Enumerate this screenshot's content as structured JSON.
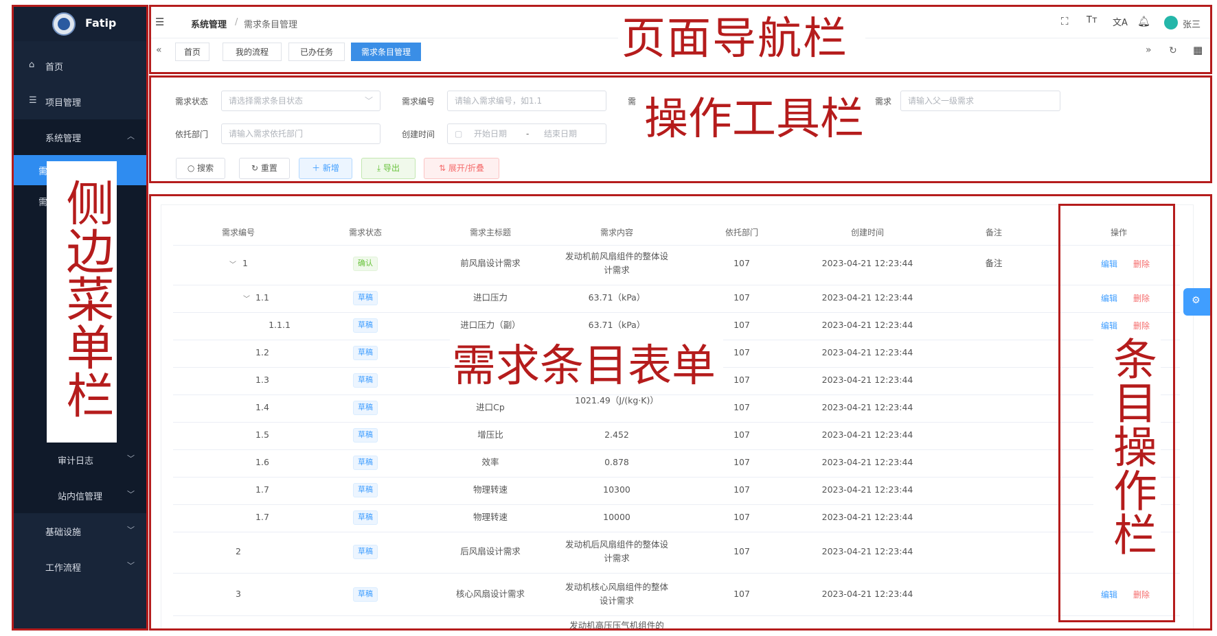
{
  "app": {
    "name": "Fatip"
  },
  "sidebar": {
    "items": [
      {
        "label": "首页",
        "icon": "home-icon"
      },
      {
        "label": "项目管理",
        "icon": "list-icon"
      },
      {
        "label": "系统管理",
        "icon": "chevron-up-icon"
      },
      {
        "label": "需"
      },
      {
        "label": "需"
      },
      {
        "label": "审计日志",
        "icon": "chevron-down-icon"
      },
      {
        "label": "站内信管理",
        "icon": "chevron-down-icon"
      },
      {
        "label": "基础设施",
        "icon": "chevron-down-icon"
      },
      {
        "label": "工作流程",
        "icon": "chevron-down-icon"
      }
    ]
  },
  "header": {
    "breadcrumb": [
      "系统管理",
      "需求条目管理"
    ],
    "breadcrumb_sep": "/",
    "user_name": "张三",
    "tabs": [
      "首页",
      "我的流程",
      "已办任务",
      "需求条目管理"
    ]
  },
  "toolbar": {
    "fields": {
      "status_label": "需求状态",
      "status_placeholder": "请选择需求条目状态",
      "code_label": "需求编号",
      "code_placeholder": "请输入需求编号，如1.1",
      "cut_label": "需",
      "parent_label": "需求",
      "parent_placeholder": "请输入父一级需求",
      "dept_label": "依托部门",
      "dept_placeholder": "请输入需求依托部门",
      "time_label": "创建时间",
      "start_placeholder": "开始日期",
      "range_sep": "-",
      "end_placeholder": "结束日期"
    },
    "buttons": {
      "search": "搜索",
      "reset": "重置",
      "add": "新增",
      "export": "导出",
      "toggle": "展开/折叠"
    }
  },
  "table": {
    "columns": [
      "需求编号",
      "需求状态",
      "需求主标题",
      "需求内容",
      "依托部门",
      "创建时间",
      "备注",
      "操作"
    ],
    "edit_label": "编辑",
    "delete_label": "删除",
    "rows": [
      {
        "code": "1",
        "status": "确认",
        "title": "前风扇设计需求",
        "content": "发动机前风扇组件的整体设计需求",
        "dept": "107",
        "time": "2023-04-21 12:23:44",
        "note": "备注"
      },
      {
        "code": "1.1",
        "status": "草稿",
        "title": "进口压力",
        "content": "63.71（kPa）",
        "dept": "107",
        "time": "2023-04-21 12:23:44",
        "note": ""
      },
      {
        "code": "1.1.1",
        "status": "草稿",
        "title": "进口压力（副）",
        "content": "63.71（kPa）",
        "dept": "107",
        "time": "2023-04-21 12:23:44",
        "note": ""
      },
      {
        "code": "1.2",
        "status": "草稿",
        "title": "",
        "content": "",
        "dept": "107",
        "time": "2023-04-21 12:23:44",
        "note": ""
      },
      {
        "code": "1.3",
        "status": "草稿",
        "title": "",
        "content": "",
        "dept": "107",
        "time": "2023-04-21 12:23:44",
        "note": ""
      },
      {
        "code": "1.4",
        "status": "草稿",
        "title": "进口Cp",
        "content": "1021.49（J/(kg·K)）",
        "dept": "107",
        "time": "2023-04-21 12:23:44",
        "note": ""
      },
      {
        "code": "1.5",
        "status": "草稿",
        "title": "增压比",
        "content": "2.452",
        "dept": "107",
        "time": "2023-04-21 12:23:44",
        "note": ""
      },
      {
        "code": "1.6",
        "status": "草稿",
        "title": "效率",
        "content": "0.878",
        "dept": "107",
        "time": "2023-04-21 12:23:44",
        "note": ""
      },
      {
        "code": "1.7",
        "status": "草稿",
        "title": "物理转速",
        "content": "10300",
        "dept": "107",
        "time": "2023-04-21 12:23:44",
        "note": ""
      },
      {
        "code": "1.7",
        "status": "草稿",
        "title": "物理转速",
        "content": "10000",
        "dept": "107",
        "time": "2023-04-21 12:23:44",
        "note": ""
      },
      {
        "code": "2",
        "status": "草稿",
        "title": "后风扇设计需求",
        "content": "发动机后风扇组件的整体设计需求",
        "dept": "107",
        "time": "2023-04-21 12:23:44",
        "note": ""
      },
      {
        "code": "3",
        "status": "草稿",
        "title": "核心风扇设计需求",
        "content": "发动机核心风扇组件的整体设计需求",
        "dept": "107",
        "time": "2023-04-21 12:23:44",
        "note": ""
      },
      {
        "code": "",
        "status": "",
        "title": "",
        "content": "发动机高压压气机组件的",
        "dept": "",
        "time": "",
        "note": ""
      }
    ]
  },
  "annotations": {
    "nav_bar": "页面导航栏",
    "toolbar": "操作工具栏",
    "sidebar": "侧边菜单栏",
    "table": "需求条目表单",
    "ops": "条目操作栏"
  },
  "colors": {
    "annotation_red": "#b51c1c",
    "sidebar_bg": "#182539",
    "accent": "#2f8cf0"
  }
}
